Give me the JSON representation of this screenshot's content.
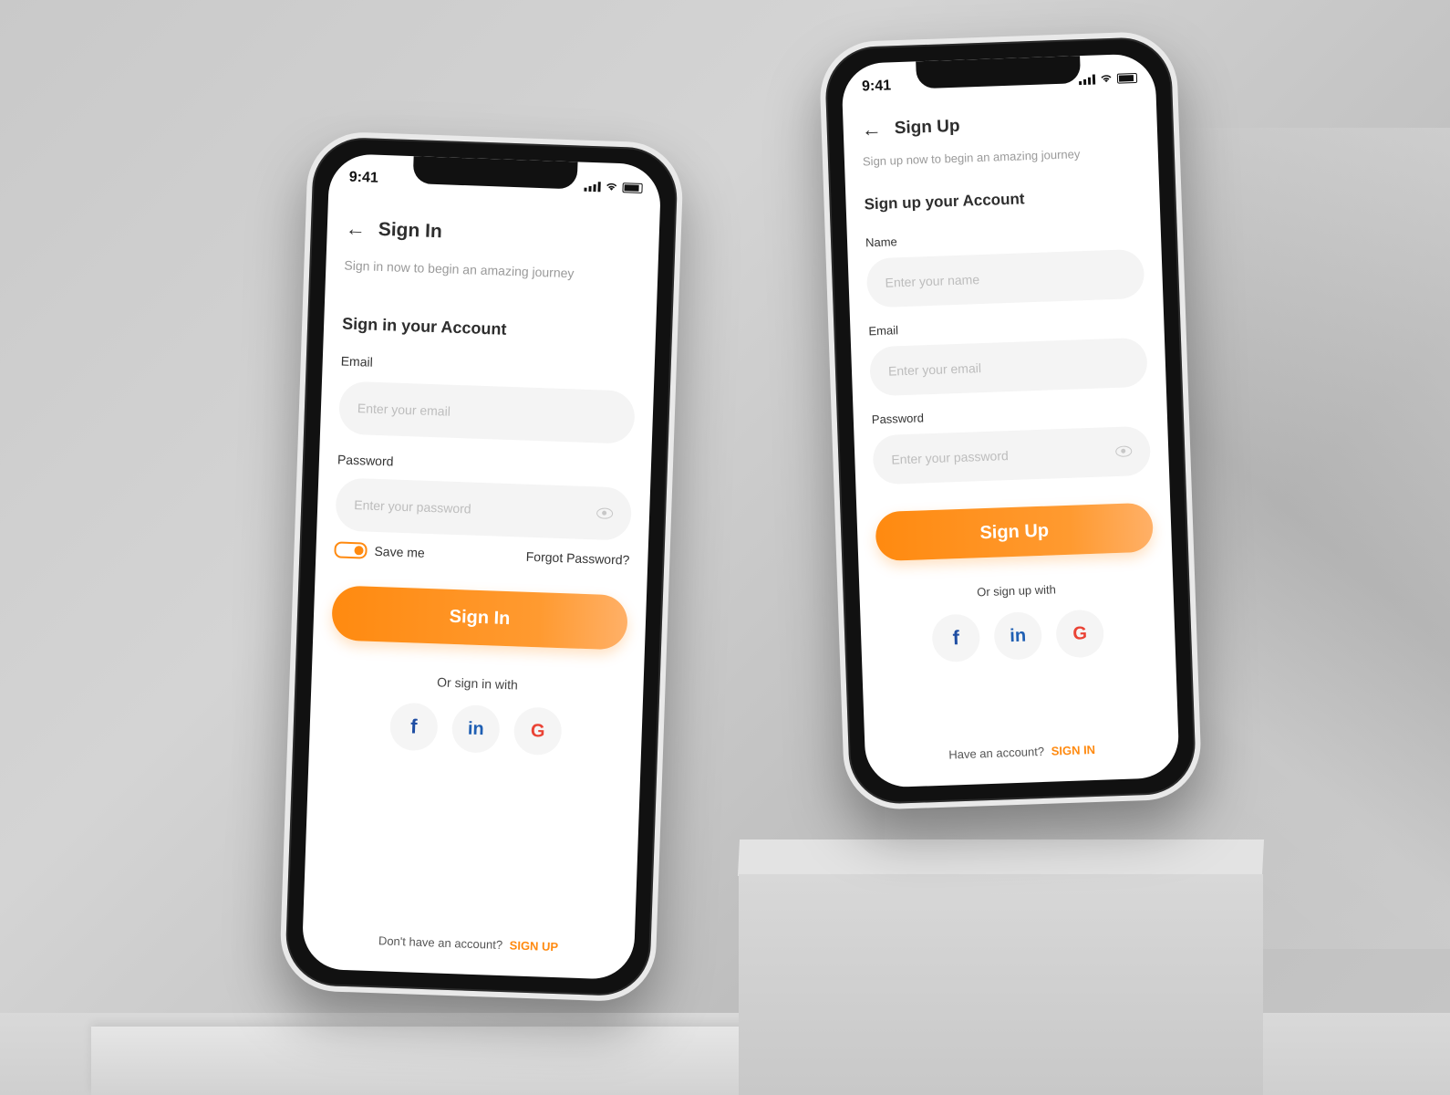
{
  "signin": {
    "time": "9:41",
    "title": "Sign In",
    "subtitle": "Sign in now to begin an amazing journey",
    "section": "Sign in your Account",
    "email_label": "Email",
    "email_placeholder": "Enter your email",
    "password_label": "Password",
    "password_placeholder": "Enter your password",
    "save_me": "Save me",
    "forgot": "Forgot Password?",
    "button": "Sign In",
    "or": "Or sign in with",
    "social": {
      "facebook": "f",
      "linkedin": "in",
      "google": "G"
    },
    "footer_text": "Don't have an account?",
    "footer_link": "SIGN UP"
  },
  "signup": {
    "time": "9:41",
    "title": "Sign Up",
    "subtitle": "Sign up now to begin an amazing journey",
    "section": "Sign up your Account",
    "name_label": "Name",
    "name_placeholder": "Enter your name",
    "email_label": "Email",
    "email_placeholder": "Enter your email",
    "password_label": "Password",
    "password_placeholder": "Enter your password",
    "button": "Sign Up",
    "or": "Or sign up with",
    "social": {
      "facebook": "f",
      "linkedin": "in",
      "google": "G"
    },
    "footer_text": "Have an account?",
    "footer_link": "SIGN IN"
  },
  "colors": {
    "accent": "#ff8a10",
    "facebook": "#1f4ea3",
    "linkedin": "#1f5fb3",
    "google": "#ea4335"
  },
  "icons": [
    "back-arrow-icon",
    "signal-icon",
    "wifi-icon",
    "battery-icon",
    "eye-icon",
    "facebook-icon",
    "linkedin-icon",
    "google-icon"
  ]
}
